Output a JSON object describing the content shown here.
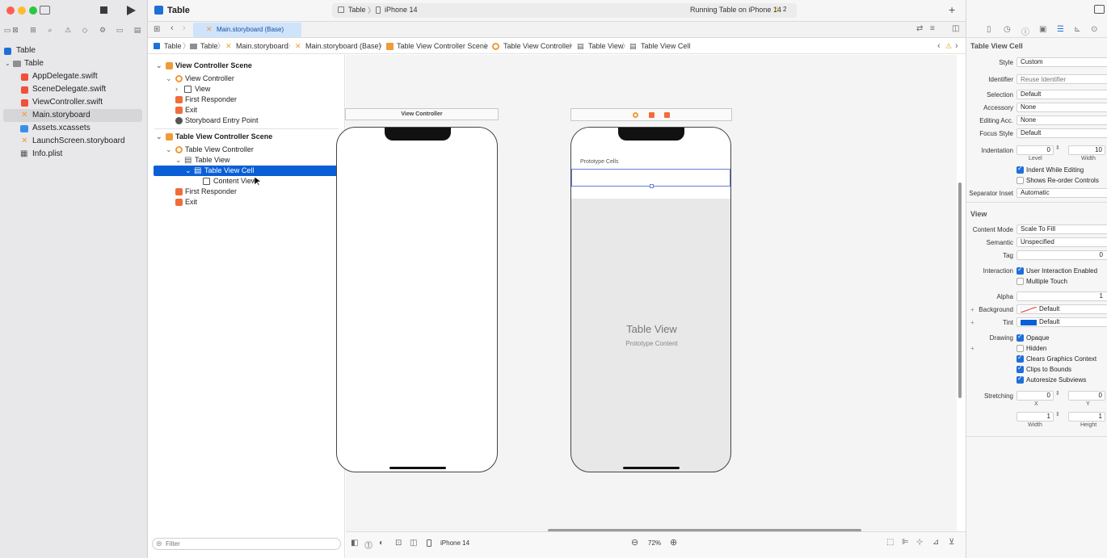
{
  "project": {
    "name": "Table",
    "group": "Table",
    "files": [
      "AppDelegate.swift",
      "SceneDelegate.swift",
      "ViewController.swift",
      "Main.storyboard",
      "Assets.xcassets",
      "LaunchScreen.storyboard",
      "Info.plist"
    ],
    "selected_file": "Main.storyboard"
  },
  "toolbar": {
    "title": "Table",
    "scheme": "Table",
    "device": "iPhone 14",
    "status": "Running Table on iPhone 14",
    "warnings": "2"
  },
  "tab": {
    "label": "Main.storyboard (Base)"
  },
  "breadcrumb": [
    "Table",
    "Table",
    "Main.storyboard",
    "Main.storyboard (Base)",
    "Table View Controller Scene",
    "Table View Controller",
    "Table View",
    "Table View Cell"
  ],
  "outline": {
    "scene1": {
      "title": "View Controller Scene",
      "vc": "View Controller",
      "view": "View",
      "responder": "First Responder",
      "exit": "Exit",
      "entry": "Storyboard Entry Point"
    },
    "scene2": {
      "title": "Table View Controller Scene",
      "tvc": "Table View Controller",
      "tv": "Table View",
      "cell": "Table View Cell",
      "content": "Content View",
      "responder": "First Responder",
      "exit": "Exit"
    },
    "filter_placeholder": "Filter"
  },
  "canvas": {
    "vc_title": "View Controller",
    "prototype_cells": "Prototype Cells",
    "tv_title": "Table View",
    "tv_subtitle": "Prototype Content",
    "zoom": "72%",
    "device": "iPhone 14"
  },
  "inspector": {
    "section1": "Table View Cell",
    "style_label": "Style",
    "style": "Custom",
    "identifier_label": "Identifier",
    "identifier_placeholder": "Reuse Identifier",
    "selection_label": "Selection",
    "selection": "Default",
    "accessory_label": "Accessory",
    "accessory": "None",
    "editing_label": "Editing Acc.",
    "editing": "None",
    "focus_label": "Focus Style",
    "focus": "Default",
    "indent_label": "Indentation",
    "indent_level": "0",
    "indent_width": "10",
    "level_caption": "Level",
    "width_caption": "Width",
    "indent_while_editing": "Indent While Editing",
    "shows_reorder": "Shows Re-order Controls",
    "sep_label": "Separator Inset",
    "sep": "Automatic",
    "section2": "View",
    "content_mode_label": "Content Mode",
    "content_mode": "Scale To Fill",
    "semantic_label": "Semantic",
    "semantic": "Unspecified",
    "tag_label": "Tag",
    "tag": "0",
    "interaction_label": "Interaction",
    "user_interaction": "User Interaction Enabled",
    "multiple_touch": "Multiple Touch",
    "alpha_label": "Alpha",
    "alpha": "1",
    "background_label": "Background",
    "background": "Default",
    "tint_label": "Tint",
    "tint": "Default",
    "drawing_label": "Drawing",
    "opaque": "Opaque",
    "hidden": "Hidden",
    "clears": "Clears Graphics Context",
    "clips": "Clips to Bounds",
    "autoresize": "Autoresize Subviews",
    "stretching_label": "Stretching",
    "stretch_x": "0",
    "stretch_y": "0",
    "stretch_w": "1",
    "stretch_h": "1",
    "x_caption": "X",
    "y_caption": "Y",
    "w_caption": "Width",
    "h_caption": "Height"
  },
  "colors": {
    "accent": "#0a5fd6",
    "swift": "#f05138",
    "storyboard": "#f19a38"
  }
}
